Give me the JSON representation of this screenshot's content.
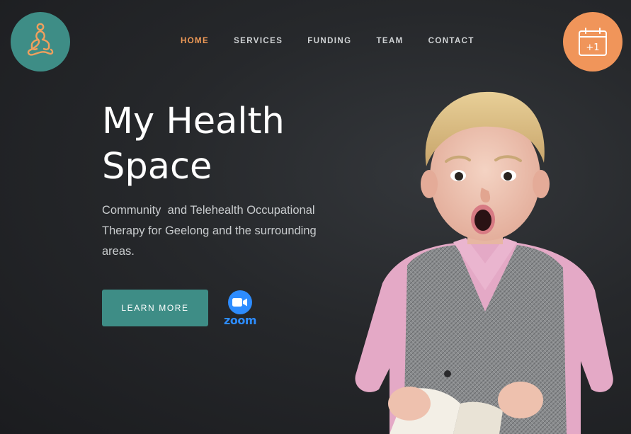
{
  "brand": {
    "logo_icon": "meditation-figure-icon",
    "logo_bg": "#3e8d86",
    "accent": "#ef9a57"
  },
  "nav": {
    "items": [
      {
        "label": "HOME",
        "active": true
      },
      {
        "label": "SERVICES",
        "active": false
      },
      {
        "label": "FUNDING",
        "active": false
      },
      {
        "label": "TEAM",
        "active": false
      },
      {
        "label": "CONTACT",
        "active": false
      }
    ]
  },
  "booking": {
    "icon": "calendar-plus-one-icon",
    "icon_text": "+1",
    "bg": "#f0955a"
  },
  "hero": {
    "title": "My Health Space",
    "subtitle": "Community  and Telehealth Occupational Therapy for Geelong and the surrounding areas.",
    "cta_label": "LEARN MORE",
    "cta_bg": "#3e8d86"
  },
  "zoom": {
    "icon": "zoom-camera-icon",
    "wordmark": "zoom",
    "color": "#2d8cff"
  },
  "photo": {
    "subject": "surprised-child-with-book-image"
  }
}
